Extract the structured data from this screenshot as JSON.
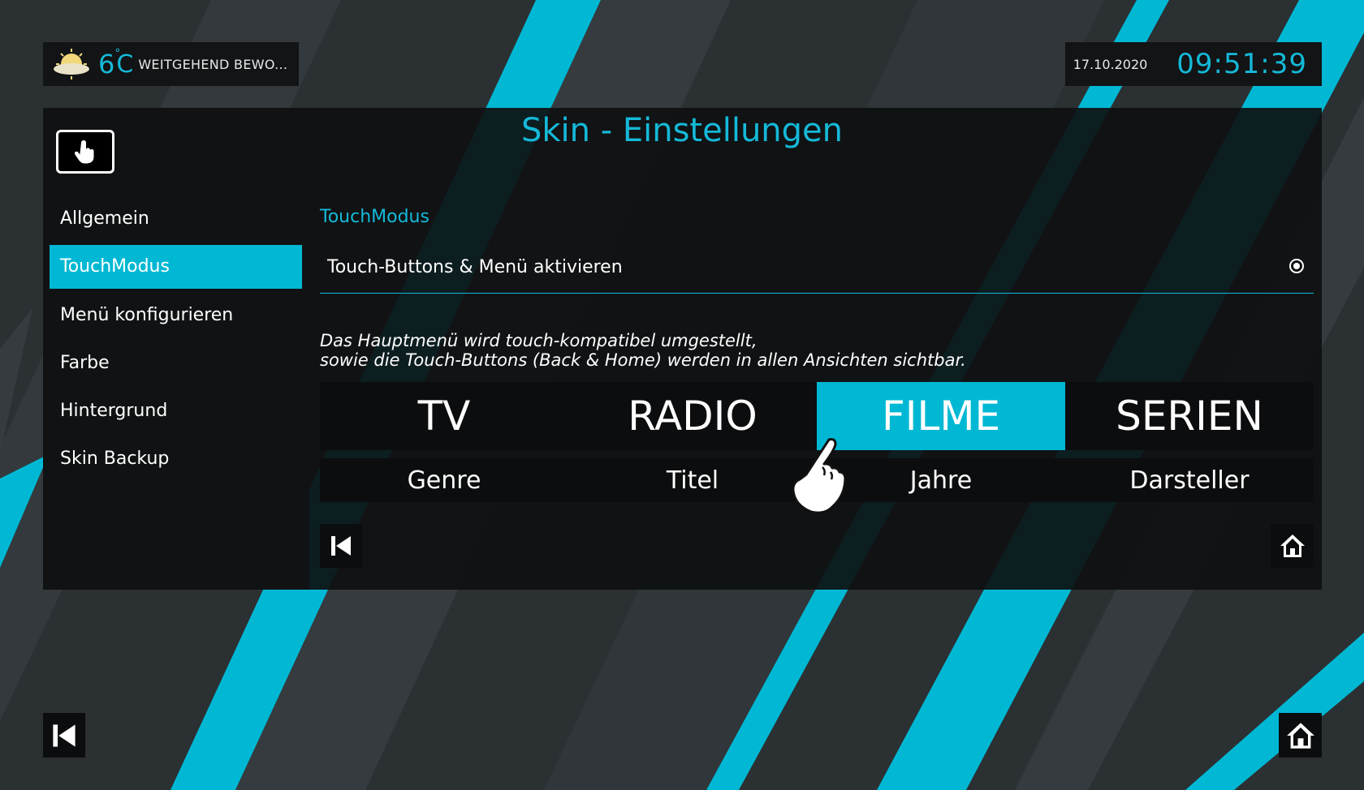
{
  "weather": {
    "temperature": "6",
    "unit": "C",
    "condition": "WEITGEHEND BEWO...",
    "icon": "partly-cloudy-icon"
  },
  "clock": {
    "date": "17.10.2020",
    "time": "09:51:39"
  },
  "page": {
    "title": "Skin - Einstellungen"
  },
  "sidebar": {
    "icon": "touch-hand-icon",
    "items": [
      {
        "label": "Allgemein",
        "active": false
      },
      {
        "label": "TouchModus",
        "active": true
      },
      {
        "label": "Menü konfigurieren",
        "active": false
      },
      {
        "label": "Farbe",
        "active": false
      },
      {
        "label": "Hintergrund",
        "active": false
      },
      {
        "label": "Skin Backup",
        "active": false
      }
    ]
  },
  "content": {
    "section_label": "TouchModus",
    "setting": {
      "label": "Touch-Buttons & Menü aktivieren",
      "enabled": true
    },
    "description": [
      "Das Hauptmenü wird touch-kompatibel umgestellt,",
      "sowie die Touch-Buttons (Back & Home) werden in allen Ansichten sichtbar."
    ],
    "menu": [
      {
        "label": "TV",
        "active": false
      },
      {
        "label": "RADIO",
        "active": false
      },
      {
        "label": "FILME",
        "active": true
      },
      {
        "label": "SERIEN",
        "active": false
      }
    ],
    "submenu": [
      "Genre",
      "Titel",
      "Jahre",
      "Darsteller"
    ]
  },
  "colors": {
    "accent": "#00b8d4",
    "background": "#2b3033",
    "panel": "#101213"
  },
  "icons": {
    "back": "skip-back-icon",
    "home": "home-icon",
    "pointer": "pointing-hand-icon"
  }
}
